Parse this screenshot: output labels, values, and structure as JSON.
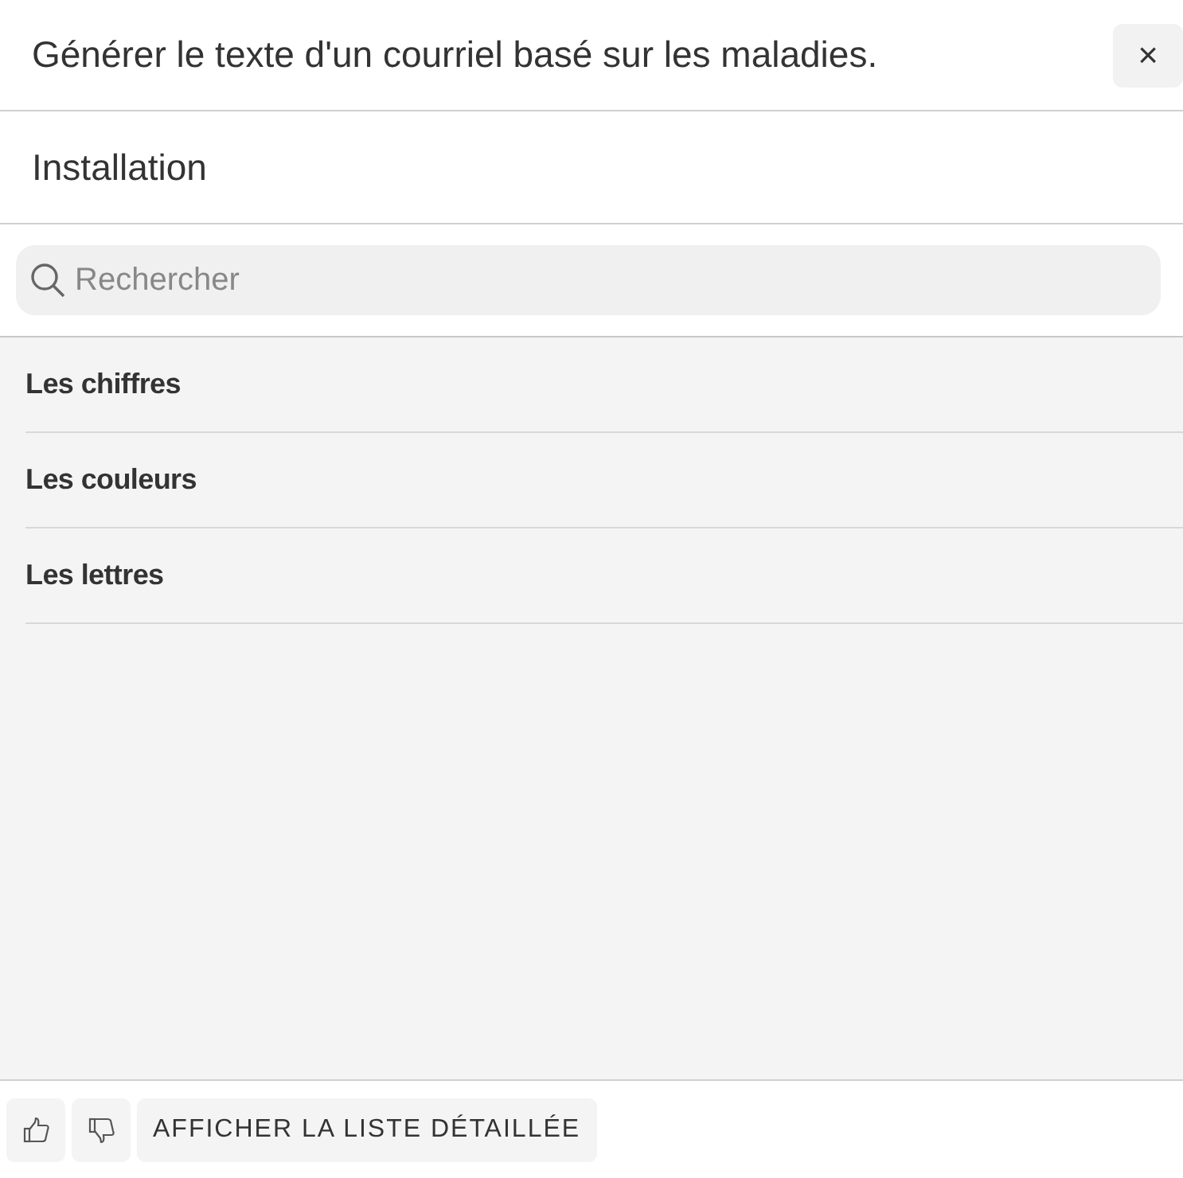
{
  "header": {
    "title": "Générer le texte d'un courriel basé sur les maladies.",
    "close": "×"
  },
  "subtitle": "Installation",
  "search": {
    "placeholder": "Rechercher"
  },
  "items": [
    {
      "label": "Les chiffres"
    },
    {
      "label": "Les couleurs"
    },
    {
      "label": "Les lettres"
    }
  ],
  "footer": {
    "button": "AFFICHER LA LISTE DÉTAILLÉE"
  }
}
